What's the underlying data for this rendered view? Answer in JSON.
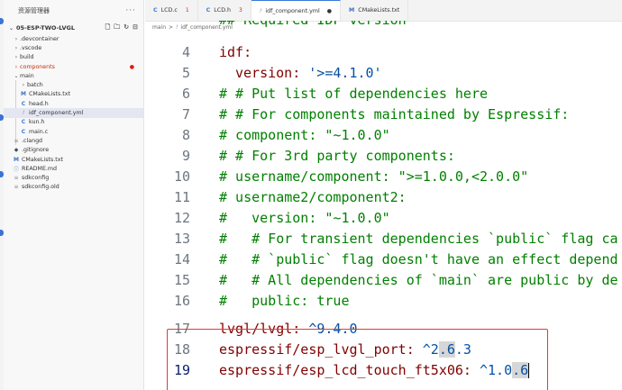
{
  "sidebar": {
    "title": "资源管理器",
    "more": "···",
    "project": "05-ESP-TWO-LVGL",
    "items": [
      {
        "label": ".devcontainer",
        "kind": "folder"
      },
      {
        "label": ".vscode",
        "kind": "folder"
      },
      {
        "label": "build",
        "kind": "folder"
      },
      {
        "label": "components",
        "kind": "folder"
      },
      {
        "label": "main",
        "kind": "folder-open"
      },
      {
        "label": "batch",
        "kind": "folder"
      },
      {
        "label": "CMakeLists.txt",
        "kind": "cmake"
      },
      {
        "label": "head.h",
        "kind": "c"
      },
      {
        "label": "idf_component.yml",
        "kind": "yml"
      },
      {
        "label": "kun.h",
        "kind": "c"
      },
      {
        "label": "main.c",
        "kind": "c"
      },
      {
        "label": ".clangd",
        "kind": "lines"
      },
      {
        "label": ".gitignore",
        "kind": "git"
      },
      {
        "label": "CMakeLists.txt",
        "kind": "cmake"
      },
      {
        "label": "README.md",
        "kind": "info"
      },
      {
        "label": "sdkconfig",
        "kind": "lines"
      },
      {
        "label": "sdkconfig.old",
        "kind": "lines"
      }
    ]
  },
  "tabs": [
    {
      "icon": "C",
      "label": "LCD.c",
      "badge": "1"
    },
    {
      "icon": "C",
      "label": "LCD.h",
      "badge": "3"
    },
    {
      "icon": "!",
      "label": "idf_component.yml",
      "badge": "●"
    },
    {
      "icon": "M",
      "label": "CMakeLists.txt",
      "badge": ""
    }
  ],
  "breadcrumb": {
    "part1": "main",
    "sep": ">",
    "icon": "!",
    "part2": "idf_component.yml"
  },
  "code": {
    "partial_top": "## Required IDF version",
    "lines": [
      {
        "n": "4",
        "text": ""
      },
      {
        "n": "5",
        "text": ""
      },
      {
        "n": "6",
        "text": "# # Put list of dependencies here"
      },
      {
        "n": "7",
        "text": "# # For components maintained by Espressif:"
      },
      {
        "n": "8",
        "text": "# component: \"~1.0.0\""
      },
      {
        "n": "9",
        "text": "# # For 3rd party components:"
      },
      {
        "n": "10",
        "text": "# username/component: \">=1.0.0,<2.0.0\""
      },
      {
        "n": "11",
        "text": "# username2/component2:"
      },
      {
        "n": "12",
        "text": "#   version: \"~1.0.0\""
      },
      {
        "n": "13",
        "text": "#   # For transient dependencies `public` flag ca"
      },
      {
        "n": "14",
        "text": "#   # `public` flag doesn't have an effect depend"
      },
      {
        "n": "15",
        "text": "#   # All dependencies of `main` are public by de"
      },
      {
        "n": "16",
        "text": "#   public: true"
      },
      {
        "n": "17",
        "text": ""
      },
      {
        "n": "18",
        "text": ""
      },
      {
        "n": "19",
        "text": ""
      }
    ],
    "idf_key": "idf:",
    "version_key": "version: ",
    "version_val": "'>=4.1.0'",
    "dep1_key": "lvgl/lvgl: ",
    "dep1_val": "^9.4.0",
    "dep2_key": "espressif/esp_lvgl_port: ",
    "dep2_val_a": "^2",
    "dep2_val_b": ".6",
    "dep2_val_c": ".3",
    "dep3_key": "espressif/esp_lcd_touch_ft5x06: ",
    "dep3_val_a": "^1.0",
    "dep3_val_b": ".6"
  }
}
